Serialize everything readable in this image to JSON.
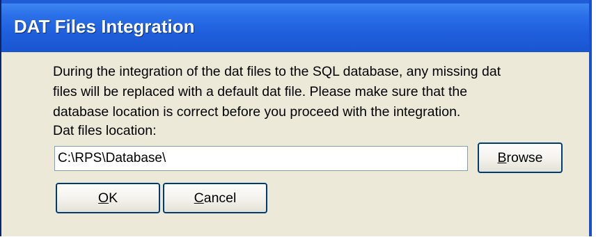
{
  "window": {
    "title": "DAT Files Integration"
  },
  "message": {
    "lines": [
      "During the integration of the dat files to the SQL database, any missing dat",
      "files will be replaced with a default dat file. Please make sure that the",
      "database location is correct before you proceed with the integration."
    ]
  },
  "location": {
    "label": "Dat files location:",
    "value": "C:\\RPS\\Database\\"
  },
  "buttons": {
    "browse": {
      "mnemonic": "B",
      "rest": "rowse"
    },
    "ok": {
      "mnemonic": "O",
      "rest": "K"
    },
    "cancel": {
      "mnemonic": "C",
      "rest": "ancel"
    }
  },
  "colors": {
    "titlebar": "#2a6fe8",
    "dialog_bg": "#ece9d8",
    "button_border": "#003c74"
  }
}
